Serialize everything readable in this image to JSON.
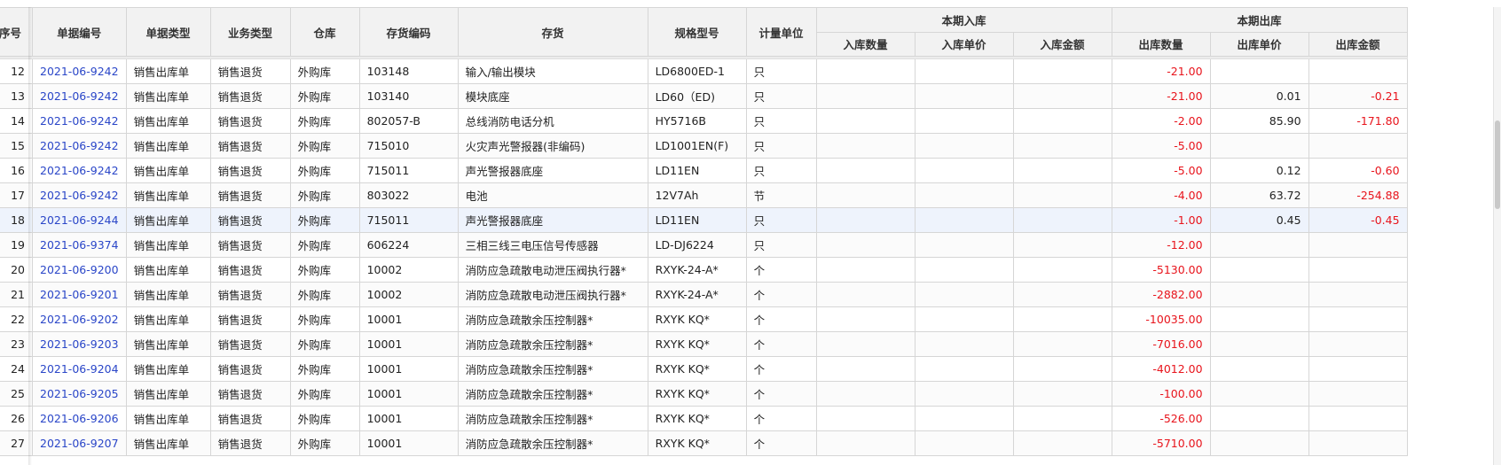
{
  "columns": {
    "seq": "序号",
    "doc_no": "单据编号",
    "doc_type": "单据类型",
    "biz_type": "业务类型",
    "warehouse": "仓库",
    "inv_code": "存货编码",
    "inventory": "存货",
    "spec": "规格型号",
    "unit": "计量单位",
    "in_group": "本期入库",
    "in_qty": "入库数量",
    "in_price": "入库单价",
    "in_amount": "入库金额",
    "out_group": "本期出库",
    "out_qty": "出库数量",
    "out_price": "出库单价",
    "out_amount": "出库金额"
  },
  "rows": [
    {
      "seq": "12",
      "doc_no": "2021-06-9242",
      "doc_type": "销售出库单",
      "biz_type": "销售退货",
      "warehouse": "外购库",
      "inv_code": "103148",
      "inventory": "输入/输出模块",
      "spec": "LD6800ED-1",
      "unit": "只",
      "in_qty": "",
      "in_price": "",
      "in_amount": "",
      "out_qty": "-21.00",
      "out_price": "",
      "out_amount": ""
    },
    {
      "seq": "13",
      "doc_no": "2021-06-9242",
      "doc_type": "销售出库单",
      "biz_type": "销售退货",
      "warehouse": "外购库",
      "inv_code": "103140",
      "inventory": "模块底座",
      "spec": "LD60（ED)",
      "unit": "只",
      "in_qty": "",
      "in_price": "",
      "in_amount": "",
      "out_qty": "-21.00",
      "out_price": "0.01",
      "out_amount": "-0.21"
    },
    {
      "seq": "14",
      "doc_no": "2021-06-9242",
      "doc_type": "销售出库单",
      "biz_type": "销售退货",
      "warehouse": "外购库",
      "inv_code": "802057-B",
      "inventory": "总线消防电话分机",
      "spec": "HY5716B",
      "unit": "只",
      "in_qty": "",
      "in_price": "",
      "in_amount": "",
      "out_qty": "-2.00",
      "out_price": "85.90",
      "out_amount": "-171.80"
    },
    {
      "seq": "15",
      "doc_no": "2021-06-9242",
      "doc_type": "销售出库单",
      "biz_type": "销售退货",
      "warehouse": "外购库",
      "inv_code": "715010",
      "inventory": "火灾声光警报器(非编码)",
      "spec": "LD1001EN(F)",
      "unit": "只",
      "in_qty": "",
      "in_price": "",
      "in_amount": "",
      "out_qty": "-5.00",
      "out_price": "",
      "out_amount": ""
    },
    {
      "seq": "16",
      "doc_no": "2021-06-9242",
      "doc_type": "销售出库单",
      "biz_type": "销售退货",
      "warehouse": "外购库",
      "inv_code": "715011",
      "inventory": "声光警报器底座",
      "spec": "LD11EN",
      "unit": "只",
      "in_qty": "",
      "in_price": "",
      "in_amount": "",
      "out_qty": "-5.00",
      "out_price": "0.12",
      "out_amount": "-0.60"
    },
    {
      "seq": "17",
      "doc_no": "2021-06-9242",
      "doc_type": "销售出库单",
      "biz_type": "销售退货",
      "warehouse": "外购库",
      "inv_code": "803022",
      "inventory": "电池",
      "spec": "12V7Ah",
      "unit": "节",
      "in_qty": "",
      "in_price": "",
      "in_amount": "",
      "out_qty": "-4.00",
      "out_price": "63.72",
      "out_amount": "-254.88"
    },
    {
      "seq": "18",
      "doc_no": "2021-06-9244",
      "doc_type": "销售出库单",
      "biz_type": "销售退货",
      "warehouse": "外购库",
      "inv_code": "715011",
      "inventory": "声光警报器底座",
      "spec": "LD11EN",
      "unit": "只",
      "in_qty": "",
      "in_price": "",
      "in_amount": "",
      "out_qty": "-1.00",
      "out_price": "0.45",
      "out_amount": "-0.45"
    },
    {
      "seq": "19",
      "doc_no": "2021-06-9374",
      "doc_type": "销售出库单",
      "biz_type": "销售退货",
      "warehouse": "外购库",
      "inv_code": "606224",
      "inventory": "三相三线三电压信号传感器",
      "spec": "LD-DJ6224",
      "unit": "只",
      "in_qty": "",
      "in_price": "",
      "in_amount": "",
      "out_qty": "-12.00",
      "out_price": "",
      "out_amount": ""
    },
    {
      "seq": "20",
      "doc_no": "2021-06-9200",
      "doc_type": "销售出库单",
      "biz_type": "销售退货",
      "warehouse": "外购库",
      "inv_code": "10002",
      "inventory": "消防应急疏散电动泄压阀执行器*",
      "spec": "RXYK-24-A*",
      "unit": "个",
      "in_qty": "",
      "in_price": "",
      "in_amount": "",
      "out_qty": "-5130.00",
      "out_price": "",
      "out_amount": ""
    },
    {
      "seq": "21",
      "doc_no": "2021-06-9201",
      "doc_type": "销售出库单",
      "biz_type": "销售退货",
      "warehouse": "外购库",
      "inv_code": "10002",
      "inventory": "消防应急疏散电动泄压阀执行器*",
      "spec": "RXYK-24-A*",
      "unit": "个",
      "in_qty": "",
      "in_price": "",
      "in_amount": "",
      "out_qty": "-2882.00",
      "out_price": "",
      "out_amount": ""
    },
    {
      "seq": "22",
      "doc_no": "2021-06-9202",
      "doc_type": "销售出库单",
      "biz_type": "销售退货",
      "warehouse": "外购库",
      "inv_code": "10001",
      "inventory": "消防应急疏散余压控制器*",
      "spec": "RXYK KQ*",
      "unit": "个",
      "in_qty": "",
      "in_price": "",
      "in_amount": "",
      "out_qty": "-10035.00",
      "out_price": "",
      "out_amount": ""
    },
    {
      "seq": "23",
      "doc_no": "2021-06-9203",
      "doc_type": "销售出库单",
      "biz_type": "销售退货",
      "warehouse": "外购库",
      "inv_code": "10001",
      "inventory": "消防应急疏散余压控制器*",
      "spec": "RXYK KQ*",
      "unit": "个",
      "in_qty": "",
      "in_price": "",
      "in_amount": "",
      "out_qty": "-7016.00",
      "out_price": "",
      "out_amount": ""
    },
    {
      "seq": "24",
      "doc_no": "2021-06-9204",
      "doc_type": "销售出库单",
      "biz_type": "销售退货",
      "warehouse": "外购库",
      "inv_code": "10001",
      "inventory": "消防应急疏散余压控制器*",
      "spec": "RXYK KQ*",
      "unit": "个",
      "in_qty": "",
      "in_price": "",
      "in_amount": "",
      "out_qty": "-4012.00",
      "out_price": "",
      "out_amount": ""
    },
    {
      "seq": "25",
      "doc_no": "2021-06-9205",
      "doc_type": "销售出库单",
      "biz_type": "销售退货",
      "warehouse": "外购库",
      "inv_code": "10001",
      "inventory": "消防应急疏散余压控制器*",
      "spec": "RXYK KQ*",
      "unit": "个",
      "in_qty": "",
      "in_price": "",
      "in_amount": "",
      "out_qty": "-100.00",
      "out_price": "",
      "out_amount": ""
    },
    {
      "seq": "26",
      "doc_no": "2021-06-9206",
      "doc_type": "销售出库单",
      "biz_type": "销售退货",
      "warehouse": "外购库",
      "inv_code": "10001",
      "inventory": "消防应急疏散余压控制器*",
      "spec": "RXYK KQ*",
      "unit": "个",
      "in_qty": "",
      "in_price": "",
      "in_amount": "",
      "out_qty": "-526.00",
      "out_price": "",
      "out_amount": ""
    },
    {
      "seq": "27",
      "doc_no": "2021-06-9207",
      "doc_type": "销售出库单",
      "biz_type": "销售退货",
      "warehouse": "外购库",
      "inv_code": "10001",
      "inventory": "消防应急疏散余压控制器*",
      "spec": "RXYK KQ*",
      "unit": "个",
      "in_qty": "",
      "in_price": "",
      "in_amount": "",
      "out_qty": "-5710.00",
      "out_price": "",
      "out_amount": ""
    }
  ],
  "highlighted_row_seq": "18",
  "colors": {
    "link": "#2a46c8",
    "negative": "#e8141c",
    "header_bg": "#f2f2f2",
    "highlight": "#eef3fc"
  }
}
